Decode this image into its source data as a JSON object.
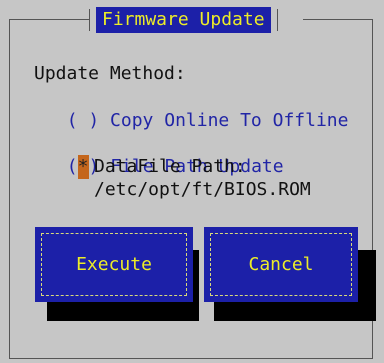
{
  "dialog": {
    "title": "Firmware Update"
  },
  "form": {
    "update_method_label": "Update Method:",
    "option_copy": {
      "marker": "( )",
      "label": "Copy Online To Offline",
      "selected": false
    },
    "option_file": {
      "marker_open": "(",
      "marker_mark": "*",
      "marker_close": ")",
      "label": "File Path Update",
      "selected": true
    },
    "datafile_path_label": "DataFile Path:",
    "datafile_path_value": "/etc/opt/ft/BIOS.ROM"
  },
  "buttons": {
    "execute": "Execute",
    "cancel": "Cancel"
  },
  "colors": {
    "background": "#c6c6c6",
    "title_bg": "#1c20a8",
    "title_fg": "#ecec28",
    "radio_text": "#2125a6",
    "selected_marker": "#c4661c"
  }
}
